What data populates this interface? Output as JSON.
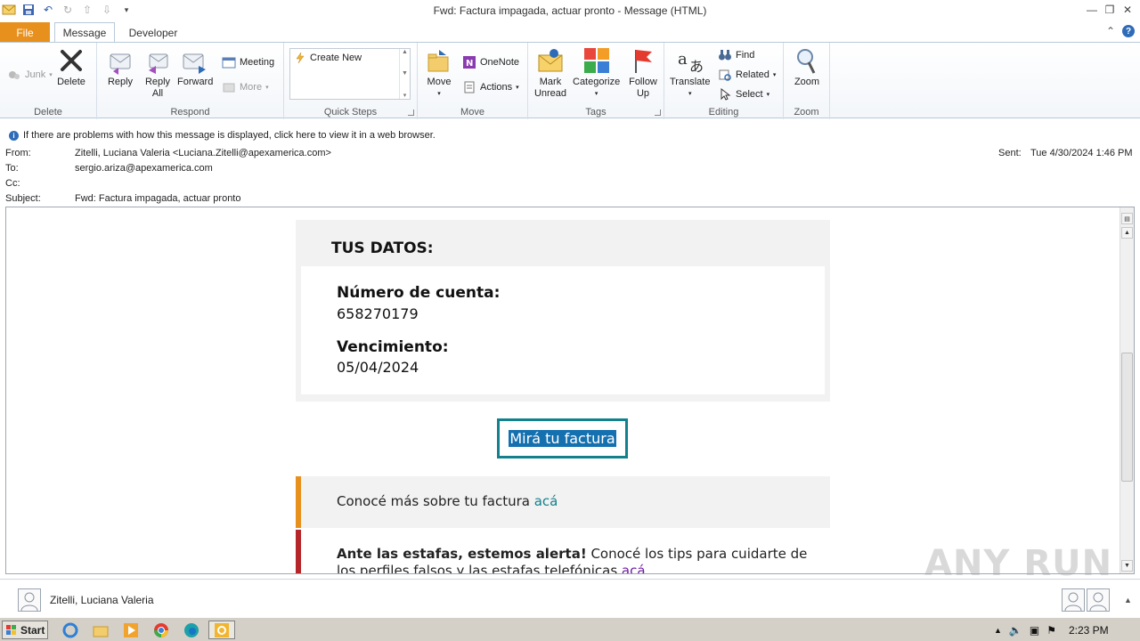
{
  "window": {
    "title": "Fwd: Factura impagada, actuar pronto  -  Message (HTML)"
  },
  "tabs": {
    "file": "File",
    "message": "Message",
    "developer": "Developer"
  },
  "ribbon": {
    "delete_group": {
      "junk": "Junk",
      "delete": "Delete",
      "label": "Delete"
    },
    "respond_group": {
      "reply": "Reply",
      "reply_all": "Reply All",
      "forward": "Forward",
      "meeting": "Meeting",
      "more": "More",
      "label": "Respond"
    },
    "quick_steps": {
      "create_new": "Create New",
      "label": "Quick Steps"
    },
    "move_group": {
      "move": "Move",
      "onenote": "OneNote",
      "actions": "Actions",
      "label": "Move"
    },
    "tags_group": {
      "mark_unread": "Mark Unread",
      "categorize": "Categorize",
      "follow_up": "Follow Up",
      "label": "Tags"
    },
    "editing_group": {
      "translate": "Translate",
      "find": "Find",
      "related": "Related",
      "select": "Select",
      "label": "Editing"
    },
    "zoom_group": {
      "zoom": "Zoom",
      "label": "Zoom"
    }
  },
  "infobar": {
    "text": "If there are problems with how this message is displayed, click here to view it in a web browser."
  },
  "headers": {
    "from_label": "From:",
    "from_value": "Zitelli, Luciana Valeria <Luciana.Zitelli@apexamerica.com>",
    "to_label": "To:",
    "to_value": "sergio.ariza@apexamerica.com",
    "cc_label": "Cc:",
    "subject_label": "Subject:",
    "subject_value": "Fwd: Factura impagada, actuar pronto",
    "sent_label": "Sent:",
    "sent_value": "Tue 4/30/2024 1:46 PM"
  },
  "message": {
    "card_title": "TUS DATOS:",
    "account_label": "Número de cuenta:",
    "account_value": "658270179",
    "due_label": "Vencimiento:",
    "due_value": "05/04/2024",
    "cta": "Mirá tu factura",
    "band1_text": "Conocé más sobre tu factura ",
    "band1_link": "acá",
    "band2_bold": "Ante las estafas, estemos alerta!",
    "band2_text": " Conocé los tips para cuidarte de",
    "band2_line2": "los perfiles falsos y las estafas telefónicas ",
    "band2_link": "acá"
  },
  "people_pane": {
    "name": "Zitelli, Luciana Valeria"
  },
  "taskbar": {
    "start": "Start",
    "clock": "2:23 PM"
  },
  "watermark": "ANY RUN",
  "colors": {
    "file_tab": "#e8901e",
    "cta_border": "#13818d",
    "cta_bg": "#1570b0",
    "band_orange": "#e8901e",
    "band_red": "#b5262a"
  }
}
